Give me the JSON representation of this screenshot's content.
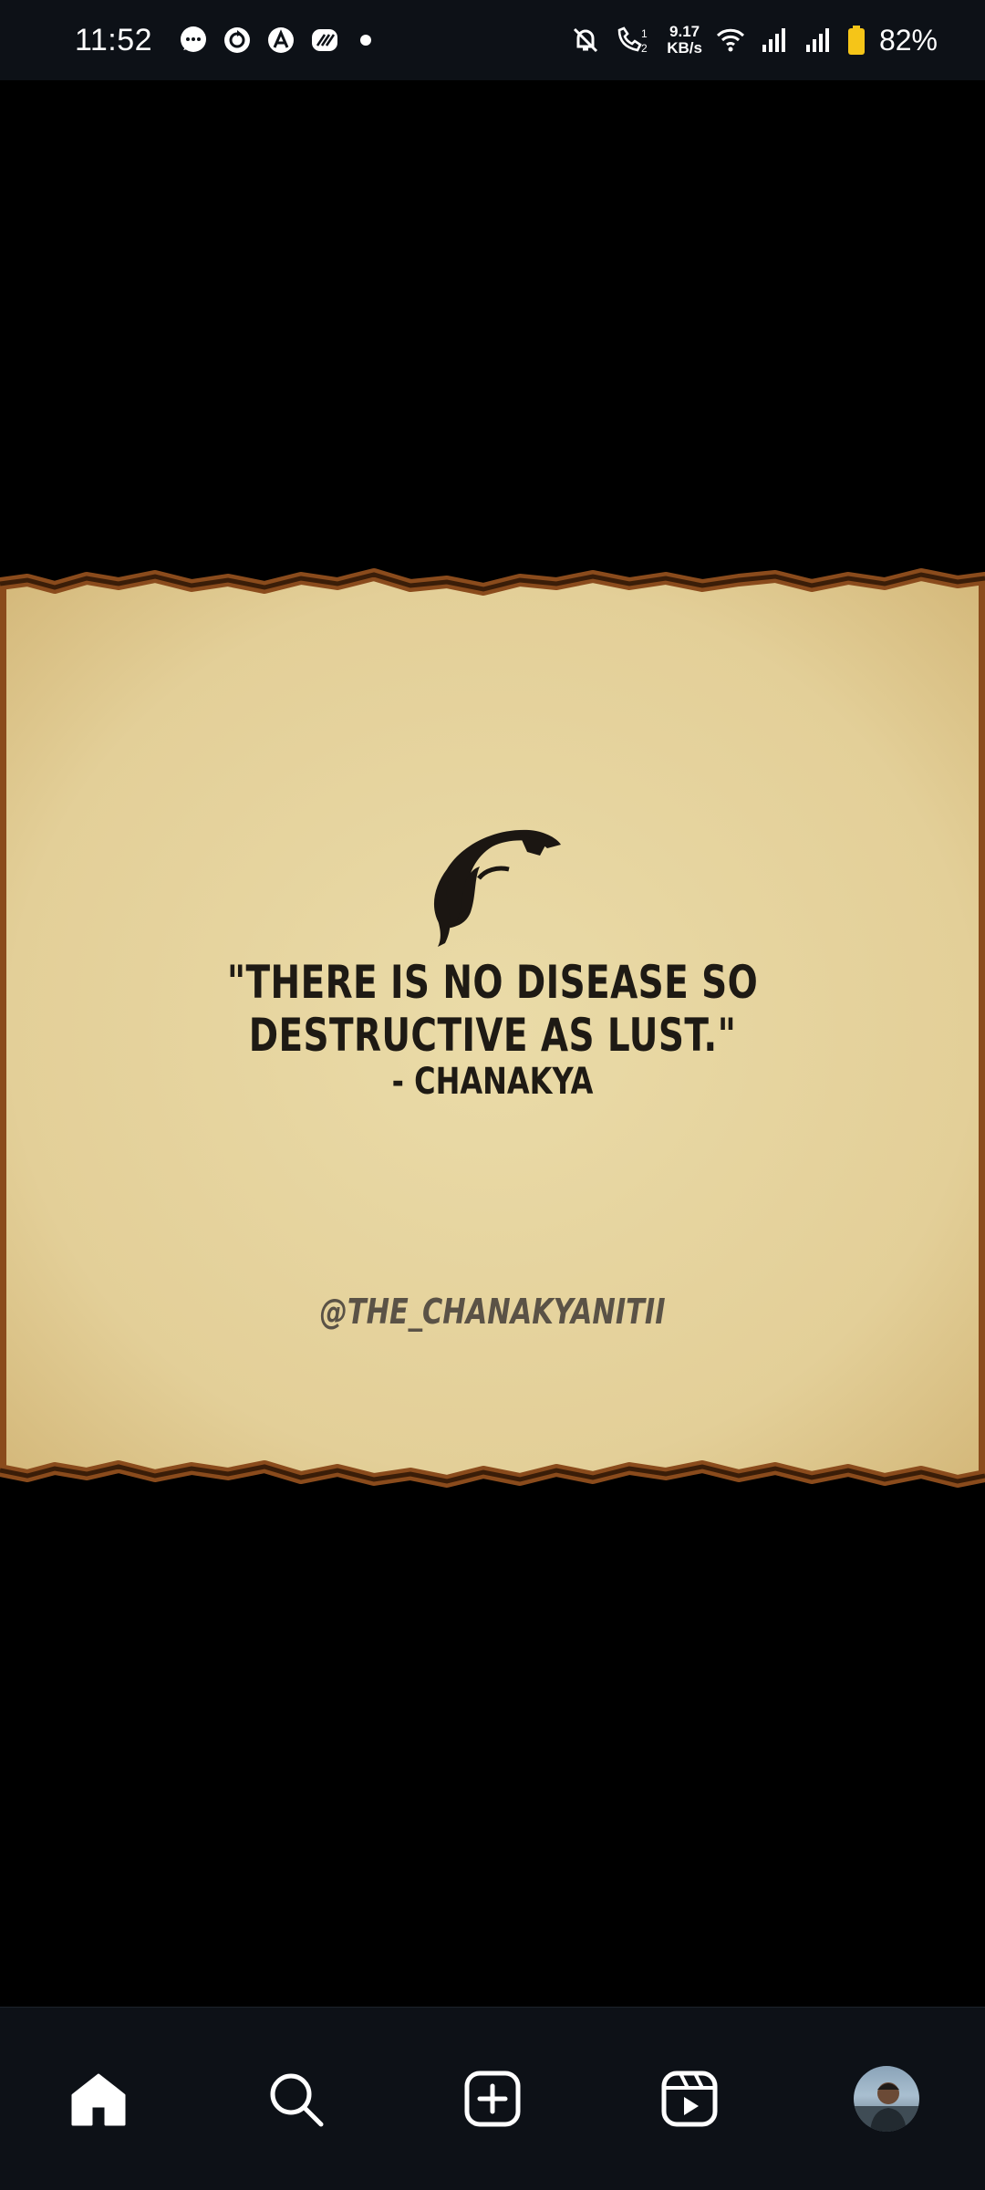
{
  "status_bar": {
    "time": "11:52",
    "notification_icons": [
      "chat-bubble-icon",
      "sync-icon",
      "a-app-icon",
      "swirl-app-icon"
    ],
    "network_speed_value": "9.17",
    "network_speed_unit": "KB/s",
    "battery_percent": "82%",
    "battery_color": "#f5c518"
  },
  "post": {
    "quote": "\"THERE IS NO DISEASE SO DESTRUCTIVE AS LUST.\"",
    "author": "- CHANAKYA",
    "handle": "@THE_CHANAKYANITII",
    "parchment_color": "#e6d3a0",
    "burnt_edge_color": "#8a4b1c"
  },
  "nav": {
    "items": [
      "home-icon",
      "search-icon",
      "create-icon",
      "reels-icon",
      "profile-avatar"
    ],
    "active": "home"
  }
}
